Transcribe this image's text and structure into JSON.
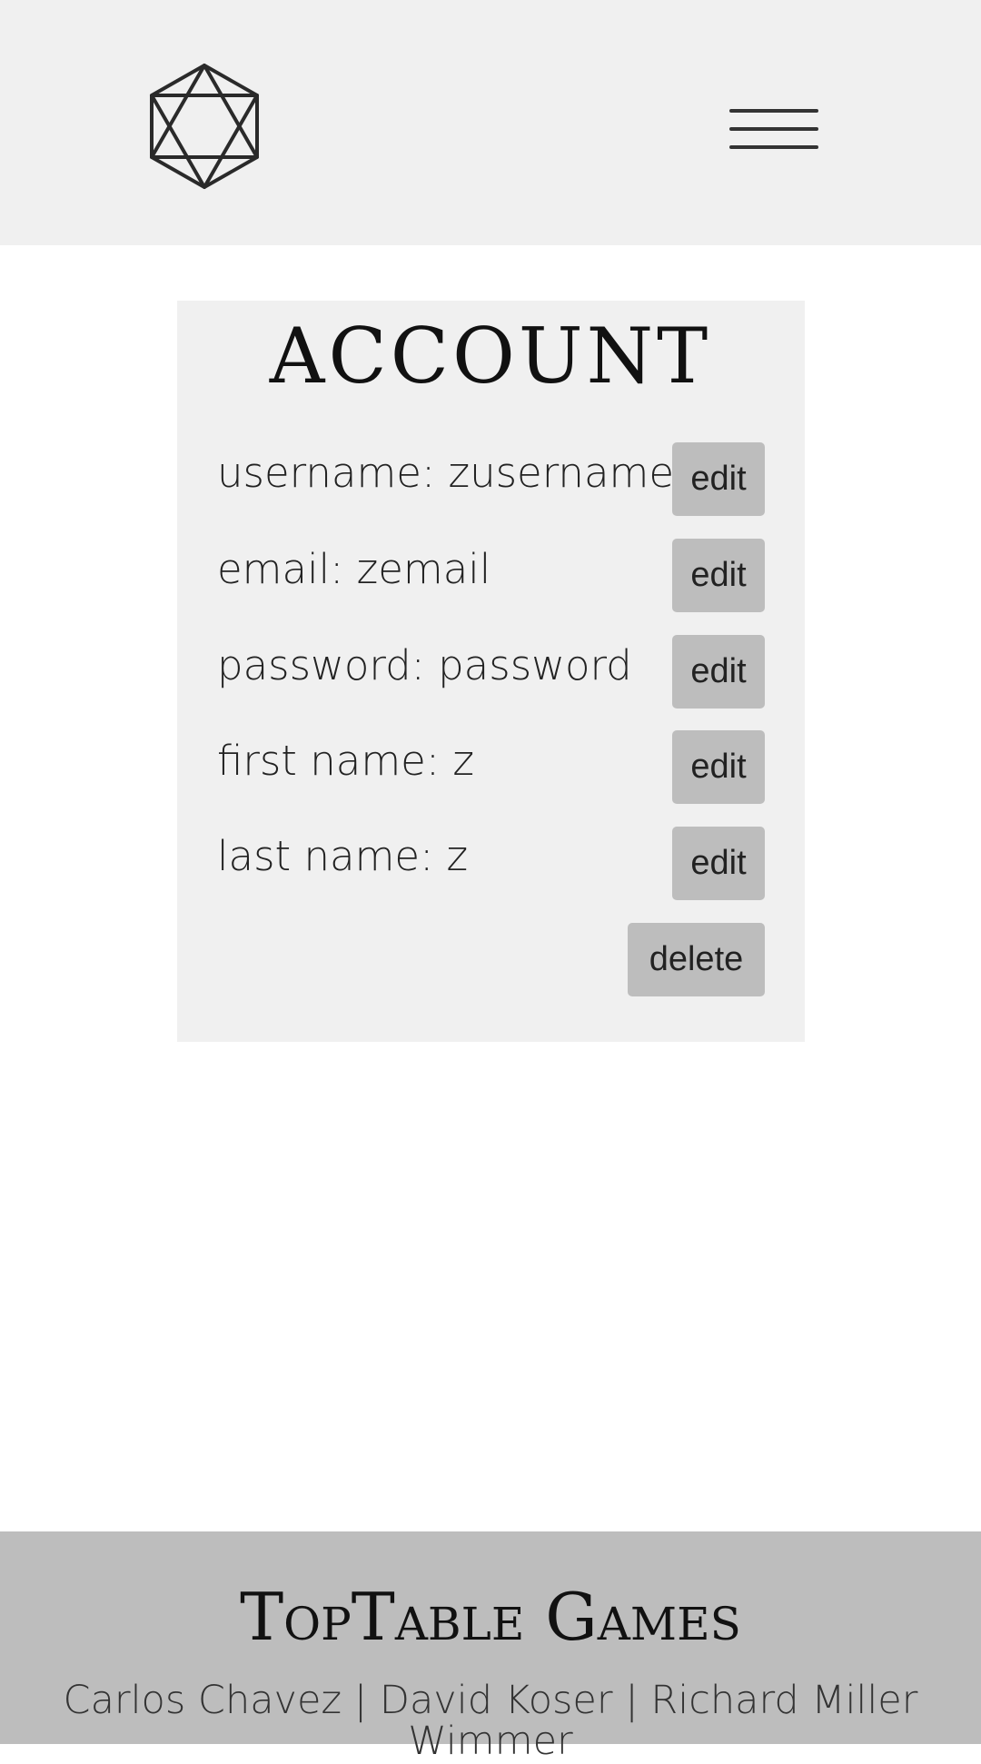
{
  "header": {
    "logo_icon": "d20-hexagram-logo-icon",
    "menu_icon": "hamburger-menu-icon"
  },
  "account": {
    "title": "ACCOUNT",
    "rows": [
      {
        "label": "username: zusername",
        "button": "edit"
      },
      {
        "label": "email: zemail",
        "button": "edit"
      },
      {
        "label": "password: password",
        "button": "edit"
      },
      {
        "label": "first name: z",
        "button": "edit"
      },
      {
        "label": "last name: z",
        "button": "edit"
      }
    ],
    "delete_label": "delete"
  },
  "footer": {
    "title": "TopTable Games",
    "credits": "Carlos Chavez | David Koser | Richard Miller Wimmer"
  },
  "colors": {
    "header_bg": "#f0f0f0",
    "card_bg": "#f0f0f0",
    "button_bg": "#bdbdbd",
    "footer_bg": "#bdbdbd"
  }
}
